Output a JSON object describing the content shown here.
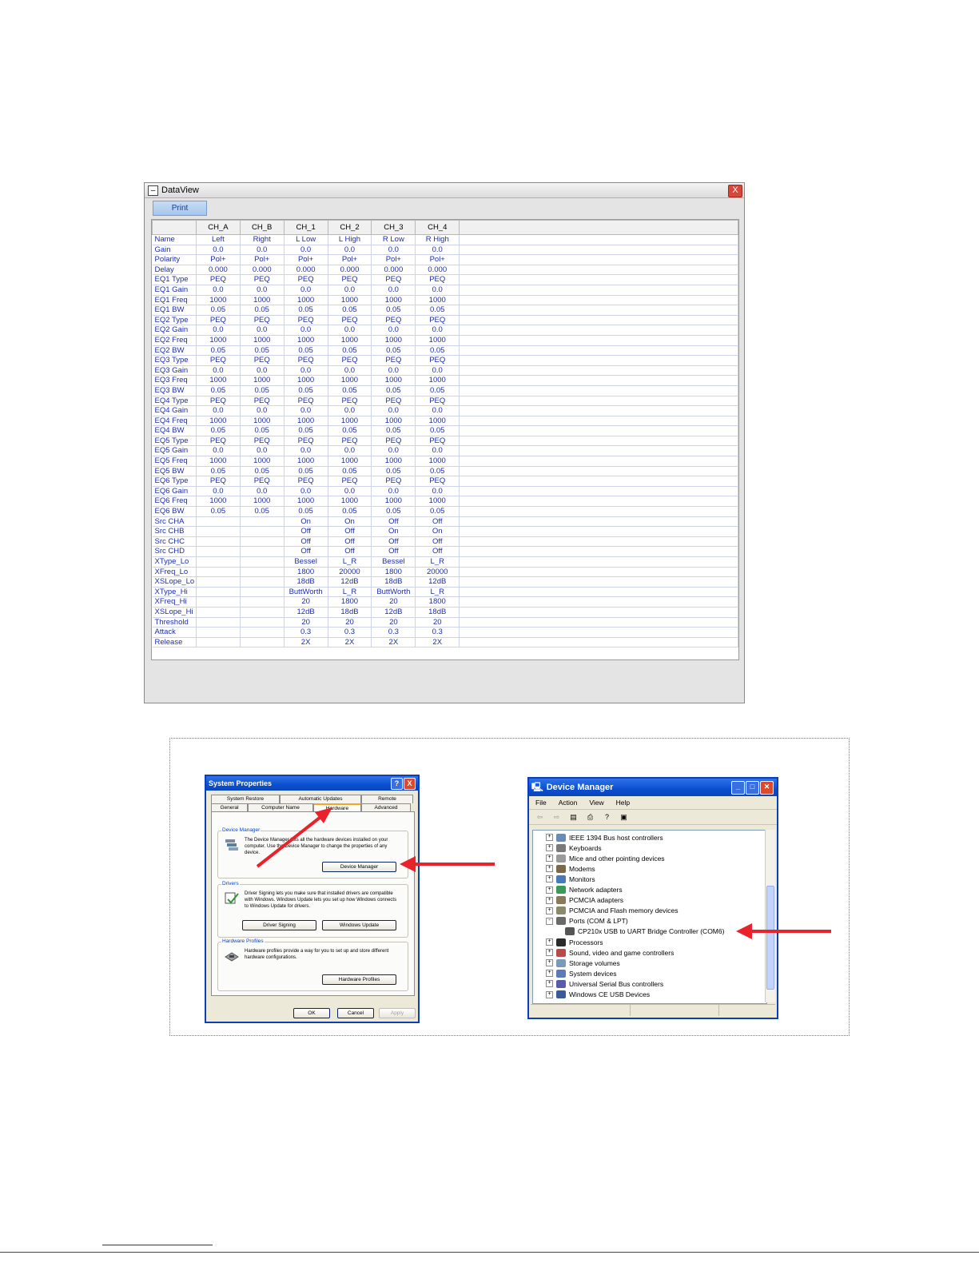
{
  "dataview": {
    "title": "DataView",
    "print_label": "Print",
    "close_glyph": "X",
    "columns": [
      "",
      "CH_A",
      "CH_B",
      "CH_1",
      "CH_2",
      "CH_3",
      "CH_4"
    ],
    "rows": [
      [
        "Name",
        "Left",
        "Right",
        "L Low",
        "L High",
        "R Low",
        "R High"
      ],
      [
        "Gain",
        "0.0",
        "0.0",
        "0.0",
        "0.0",
        "0.0",
        "0.0"
      ],
      [
        "Polarity",
        "Pol+",
        "Pol+",
        "Pol+",
        "Pol+",
        "Pol+",
        "Pol+"
      ],
      [
        "Delay",
        "0.000",
        "0.000",
        "0.000",
        "0.000",
        "0.000",
        "0.000"
      ],
      [
        "EQ1 Type",
        "PEQ",
        "PEQ",
        "PEQ",
        "PEQ",
        "PEQ",
        "PEQ"
      ],
      [
        "EQ1 Gain",
        "0.0",
        "0.0",
        "0.0",
        "0.0",
        "0.0",
        "0.0"
      ],
      [
        "EQ1 Freq",
        "1000",
        "1000",
        "1000",
        "1000",
        "1000",
        "1000"
      ],
      [
        "EQ1 BW",
        "0.05",
        "0.05",
        "0.05",
        "0.05",
        "0.05",
        "0.05"
      ],
      [
        "EQ2 Type",
        "PEQ",
        "PEQ",
        "PEQ",
        "PEQ",
        "PEQ",
        "PEQ"
      ],
      [
        "EQ2 Gain",
        "0.0",
        "0.0",
        "0.0",
        "0.0",
        "0.0",
        "0.0"
      ],
      [
        "EQ2 Freq",
        "1000",
        "1000",
        "1000",
        "1000",
        "1000",
        "1000"
      ],
      [
        "EQ2 BW",
        "0.05",
        "0.05",
        "0.05",
        "0.05",
        "0.05",
        "0.05"
      ],
      [
        "EQ3 Type",
        "PEQ",
        "PEQ",
        "PEQ",
        "PEQ",
        "PEQ",
        "PEQ"
      ],
      [
        "EQ3 Gain",
        "0.0",
        "0.0",
        "0.0",
        "0.0",
        "0.0",
        "0.0"
      ],
      [
        "EQ3 Freq",
        "1000",
        "1000",
        "1000",
        "1000",
        "1000",
        "1000"
      ],
      [
        "EQ3 BW",
        "0.05",
        "0.05",
        "0.05",
        "0.05",
        "0.05",
        "0.05"
      ],
      [
        "EQ4 Type",
        "PEQ",
        "PEQ",
        "PEQ",
        "PEQ",
        "PEQ",
        "PEQ"
      ],
      [
        "EQ4 Gain",
        "0.0",
        "0.0",
        "0.0",
        "0.0",
        "0.0",
        "0.0"
      ],
      [
        "EQ4 Freq",
        "1000",
        "1000",
        "1000",
        "1000",
        "1000",
        "1000"
      ],
      [
        "EQ4 BW",
        "0.05",
        "0.05",
        "0.05",
        "0.05",
        "0.05",
        "0.05"
      ],
      [
        "EQ5 Type",
        "PEQ",
        "PEQ",
        "PEQ",
        "PEQ",
        "PEQ",
        "PEQ"
      ],
      [
        "EQ5 Gain",
        "0.0",
        "0.0",
        "0.0",
        "0.0",
        "0.0",
        "0.0"
      ],
      [
        "EQ5 Freq",
        "1000",
        "1000",
        "1000",
        "1000",
        "1000",
        "1000"
      ],
      [
        "EQ5 BW",
        "0.05",
        "0.05",
        "0.05",
        "0.05",
        "0.05",
        "0.05"
      ],
      [
        "EQ6 Type",
        "PEQ",
        "PEQ",
        "PEQ",
        "PEQ",
        "PEQ",
        "PEQ"
      ],
      [
        "EQ6 Gain",
        "0.0",
        "0.0",
        "0.0",
        "0.0",
        "0.0",
        "0.0"
      ],
      [
        "EQ6 Freq",
        "1000",
        "1000",
        "1000",
        "1000",
        "1000",
        "1000"
      ],
      [
        "EQ6 BW",
        "0.05",
        "0.05",
        "0.05",
        "0.05",
        "0.05",
        "0.05"
      ],
      [
        "Src CHA",
        "",
        "",
        "On",
        "On",
        "Off",
        "Off"
      ],
      [
        "Src CHB",
        "",
        "",
        "Off",
        "Off",
        "On",
        "On"
      ],
      [
        "Src CHC",
        "",
        "",
        "Off",
        "Off",
        "Off",
        "Off"
      ],
      [
        "Src CHD",
        "",
        "",
        "Off",
        "Off",
        "Off",
        "Off"
      ],
      [
        "XType_Lo",
        "",
        "",
        "Bessel",
        "L_R",
        "Bessel",
        "L_R"
      ],
      [
        "XFreq_Lo",
        "",
        "",
        "1800",
        "20000",
        "1800",
        "20000"
      ],
      [
        "XSLope_Lo",
        "",
        "",
        "18dB",
        "12dB",
        "18dB",
        "12dB"
      ],
      [
        "XType_Hi",
        "",
        "",
        "ButtWorth",
        "L_R",
        "ButtWorth",
        "L_R"
      ],
      [
        "XFreq_Hi",
        "",
        "",
        "20",
        "1800",
        "20",
        "1800"
      ],
      [
        "XSLope_Hi",
        "",
        "",
        "12dB",
        "18dB",
        "12dB",
        "18dB"
      ],
      [
        "Threshold",
        "",
        "",
        "20",
        "20",
        "20",
        "20"
      ],
      [
        "Attack",
        "",
        "",
        "0.3",
        "0.3",
        "0.3",
        "0.3"
      ],
      [
        "Release",
        "",
        "",
        "2X",
        "2X",
        "2X",
        "2X"
      ]
    ]
  },
  "system_properties": {
    "title": "System Properties",
    "help_glyph": "?",
    "close_glyph": "X",
    "tabs_back": [
      "System Restore",
      "Automatic Updates",
      "Remote"
    ],
    "tabs_front": [
      "General",
      "Computer Name",
      "Hardware",
      "Advanced"
    ],
    "active_tab": "Hardware",
    "device_manager": {
      "label": "Device Manager",
      "text": "The Device Manager lists all the hardware devices installed on your computer. Use the Device Manager to change the properties of any device.",
      "button": "Device Manager"
    },
    "drivers": {
      "label": "Drivers",
      "text": "Driver Signing lets you make sure that installed drivers are compatible with Windows. Windows Update lets you set up how Windows connects to Windows Update for drivers.",
      "button_signing": "Driver Signing",
      "button_update": "Windows Update"
    },
    "hardware_profiles": {
      "label": "Hardware Profiles",
      "text": "Hardware profiles provide a way for you to set up and store different hardware configurations.",
      "button": "Hardware Profiles"
    },
    "ok": "OK",
    "cancel": "Cancel",
    "apply": "Apply"
  },
  "device_manager": {
    "title": "Device Manager",
    "menu": [
      "File",
      "Action",
      "View",
      "Help"
    ],
    "tree": [
      {
        "label": "IEEE 1394 Bus host controllers",
        "expander": "+",
        "icon": "bus-icon"
      },
      {
        "label": "Keyboards",
        "expander": "+",
        "icon": "keyboard-icon"
      },
      {
        "label": "Mice and other pointing devices",
        "expander": "+",
        "icon": "mouse-icon"
      },
      {
        "label": "Modems",
        "expander": "+",
        "icon": "modem-icon"
      },
      {
        "label": "Monitors",
        "expander": "+",
        "icon": "monitor-icon"
      },
      {
        "label": "Network adapters",
        "expander": "+",
        "icon": "network-icon"
      },
      {
        "label": "PCMCIA adapters",
        "expander": "+",
        "icon": "pcmcia-icon"
      },
      {
        "label": "PCMCIA and Flash memory devices",
        "expander": "+",
        "icon": "flash-icon"
      },
      {
        "label": "Ports (COM & LPT)",
        "expander": "-",
        "icon": "port-icon"
      },
      {
        "label": "CP210x USB to UART Bridge Controller (COM6)",
        "expander": "",
        "icon": "usb-port-icon",
        "child": true
      },
      {
        "label": "Processors",
        "expander": "+",
        "icon": "processor-icon"
      },
      {
        "label": "Sound, video and game controllers",
        "expander": "+",
        "icon": "sound-icon"
      },
      {
        "label": "Storage volumes",
        "expander": "+",
        "icon": "storage-icon"
      },
      {
        "label": "System devices",
        "expander": "+",
        "icon": "system-icon"
      },
      {
        "label": "Universal Serial Bus controllers",
        "expander": "+",
        "icon": "usb-icon"
      },
      {
        "label": "Windows CE USB Devices",
        "expander": "+",
        "icon": "ce-usb-icon"
      }
    ]
  },
  "colors": {
    "dataview_text": "#1e2fa8",
    "xp_title_blue": "#0a4fcf",
    "arrow_red": "#e8232b"
  }
}
